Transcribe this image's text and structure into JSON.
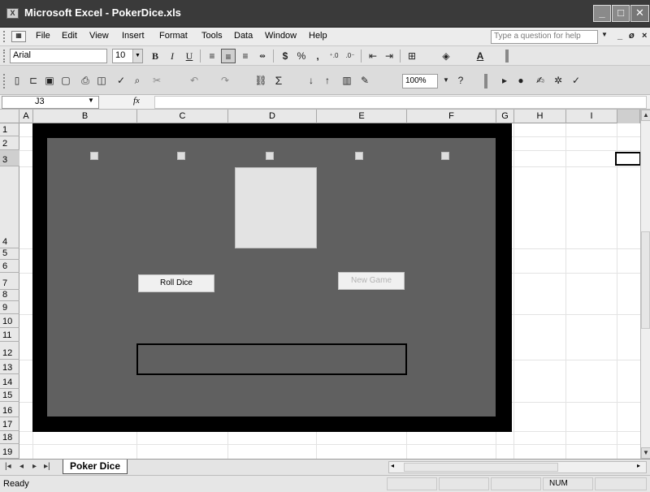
{
  "window": {
    "title": "Microsoft Excel - PokerDice.xls",
    "app_icon": "excel-icon",
    "minimize": "_",
    "maximize": "□",
    "close": "✕"
  },
  "menu": {
    "items": [
      "File",
      "Edit",
      "View",
      "Insert",
      "Format",
      "Tools",
      "Data",
      "Window",
      "Help"
    ],
    "help_placeholder": "Type a question for help"
  },
  "format_toolbar": {
    "font": "Arial",
    "size": "10",
    "bold": "B",
    "italic": "I",
    "underline": "U",
    "currency": "$",
    "percent": "%",
    "comma": ","
  },
  "standard_toolbar": {
    "zoom": "100%",
    "sum": "Σ"
  },
  "formula_bar": {
    "name_box": "J3",
    "fx": "fx",
    "formula": ""
  },
  "columns": [
    "A",
    "B",
    "C",
    "D",
    "E",
    "F",
    "G",
    "H",
    "I"
  ],
  "rows": [
    "1",
    "2",
    "3",
    "4",
    "5",
    "6",
    "7",
    "8",
    "9",
    "10",
    "11",
    "12",
    "13",
    "14",
    "15",
    "16",
    "17",
    "18",
    "19"
  ],
  "game": {
    "roll_button": "Roll Dice",
    "new_game_button": "New Game",
    "result_text": ""
  },
  "sheet_tabs": [
    "Poker Dice"
  ],
  "status": {
    "ready": "Ready",
    "num": "NUM"
  },
  "colors": {
    "board_border": "#000000",
    "board_fill": "#606060",
    "die_fill": "#e3e3e3"
  }
}
